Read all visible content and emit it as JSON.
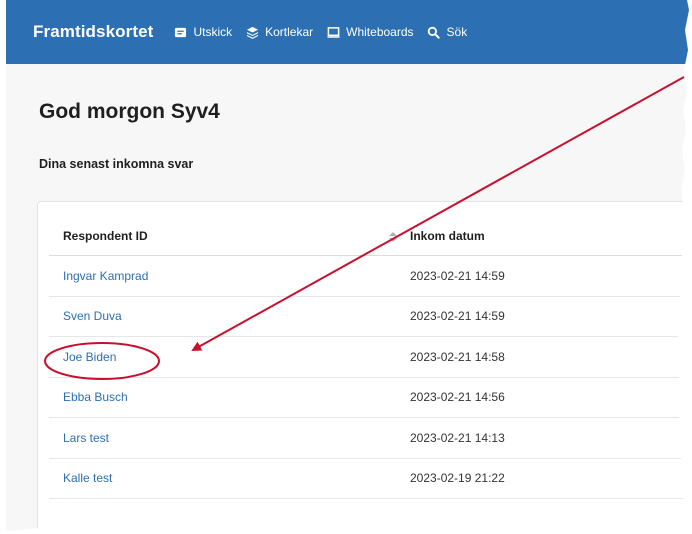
{
  "nav": {
    "brand": "Framtidskortet",
    "items": [
      {
        "label": "Utskick",
        "icon": "mail-icon"
      },
      {
        "label": "Kortlekar",
        "icon": "layers-icon"
      },
      {
        "label": "Whiteboards",
        "icon": "monitor-icon"
      },
      {
        "label": "Sök",
        "icon": "search-icon"
      }
    ]
  },
  "main": {
    "greeting": "God morgon Syv4",
    "subheading": "Dina senast inkomna svar"
  },
  "table": {
    "columns": [
      "Respondent ID",
      "Inkom datum"
    ],
    "rows": [
      {
        "id": "Ingvar Kamprad",
        "date": "2023-02-21 14:59"
      },
      {
        "id": "Sven Duva",
        "date": "2023-02-21 14:59"
      },
      {
        "id": "Joe Biden",
        "date": "2023-02-21 14:58"
      },
      {
        "id": "Ebba Busch",
        "date": "2023-02-21 14:56"
      },
      {
        "id": "Lars test",
        "date": "2023-02-21 14:13"
      },
      {
        "id": "Kalle test",
        "date": "2023-02-19 21:22"
      }
    ]
  },
  "colors": {
    "navbar": "#2c6fb3",
    "link": "#2c6fb3",
    "annotation": "#c8102e"
  }
}
